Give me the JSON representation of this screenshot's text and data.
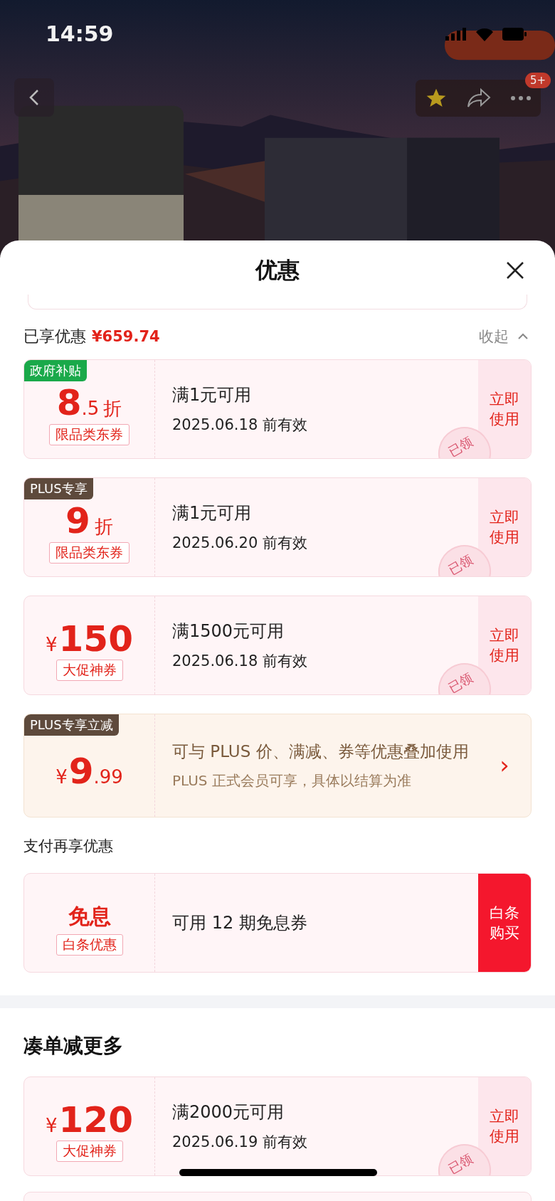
{
  "status_bar": {
    "time": "14:59"
  },
  "nav": {
    "badge": "5+"
  },
  "sheet": {
    "title": "优惠"
  },
  "enjoyed": {
    "label": "已享优惠",
    "amount": "¥659.74",
    "toggle": "收起"
  },
  "coupons": [
    {
      "kind": "coupon",
      "tag": {
        "text": "政府补贴",
        "color": "#1aa94a"
      },
      "value": {
        "main": "8",
        "decimal": ".5",
        "unit": "折"
      },
      "note": "限品类东券",
      "title": "满1元可用",
      "validity": "2025.06.18 前有效",
      "action": {
        "kind": "use",
        "text": "立即使用"
      },
      "stamp": "已领"
    },
    {
      "kind": "coupon",
      "tag": {
        "text": "PLUS专享",
        "color": "#5e4a3c"
      },
      "value": {
        "main": "9",
        "unit": "折"
      },
      "note": "限品类东券",
      "title": "满1元可用",
      "validity": "2025.06.20 前有效",
      "action": {
        "kind": "use",
        "text": "立即使用"
      },
      "stamp": "已领"
    },
    {
      "kind": "coupon",
      "value": {
        "currency": "¥",
        "main": "150"
      },
      "note": "大促神券",
      "title": "满1500元可用",
      "validity": "2025.06.18 前有效",
      "action": {
        "kind": "use",
        "text": "立即使用"
      },
      "stamp": "已领"
    },
    {
      "kind": "plus",
      "tag": {
        "text": "PLUS专享立减",
        "color": "#5e4a3c"
      },
      "value": {
        "currency": "¥",
        "main": "9",
        "decimal": ".99"
      },
      "title": "可与 PLUS 价、满减、券等优惠叠加使用",
      "validity": "PLUS 正式会员可享，具体以结算为准",
      "action": {
        "kind": "arrow",
        "text": "›"
      }
    }
  ],
  "pay_section": {
    "title": "支付再享优惠",
    "coupons": [
      {
        "kind": "coupon",
        "value": {
          "word": "免息"
        },
        "note": "白条优惠",
        "title": "可用 12 期免息券",
        "action": {
          "kind": "buy",
          "text": "白条购买"
        }
      }
    ]
  },
  "more_section": {
    "title": "凑单减更多",
    "coupons": [
      {
        "kind": "coupon",
        "value": {
          "currency": "¥",
          "main": "120"
        },
        "note": "大促神券",
        "title": "满2000元可用",
        "validity": "2025.06.19 前有效",
        "action": {
          "kind": "use",
          "text": "立即使用"
        },
        "stamp": "已领"
      }
    ]
  }
}
